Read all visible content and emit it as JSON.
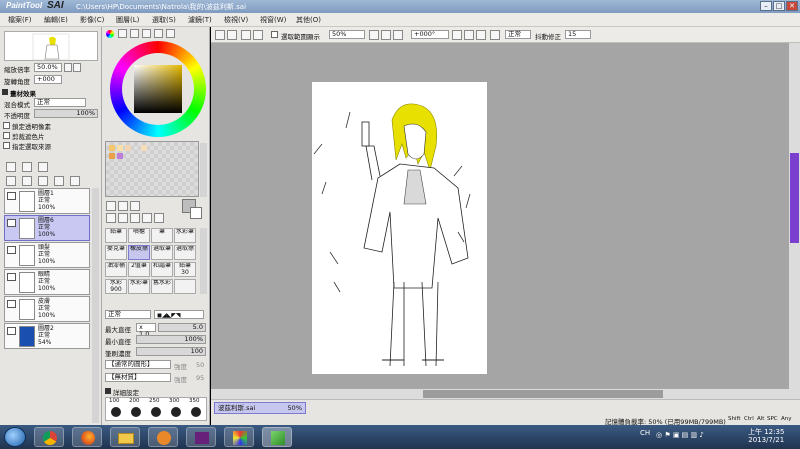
{
  "app": {
    "logo_text": "PaintTool",
    "logo_name": "SAI",
    "file_path": "C:\\Users\\HP\\Documents\\Natrola\\我的\\波茲利斯.sai"
  },
  "menubar": {
    "items": [
      "檔案(F)",
      "編輯(E)",
      "影像(C)",
      "圖層(L)",
      "選取(S)",
      "濾鏡(T)",
      "檢視(V)",
      "視窗(W)",
      "其他(O)"
    ]
  },
  "navigator": {
    "zoom_label": "縮放倍率",
    "zoom_value": "50.0%",
    "angle_label": "旋轉角度",
    "angle_value": "+000"
  },
  "layer_panel": {
    "effects_label": "畫材效果",
    "blend_label": "混合模式",
    "blend_value": "正常",
    "opacity_label": "不透明度",
    "opacity_value": "100%",
    "options": [
      "鎖定透明像素",
      "剪裁遮色片",
      "指定選取來源"
    ],
    "layers": [
      {
        "name": "圖層1",
        "mode": "正常",
        "opacity": "100%",
        "selected": false
      },
      {
        "name": "圖層6",
        "mode": "正常",
        "opacity": "100%",
        "selected": true
      },
      {
        "name": "頭髮",
        "mode": "正常",
        "opacity": "100%",
        "selected": false
      },
      {
        "name": "眼睛",
        "mode": "正常",
        "opacity": "100%",
        "selected": false
      },
      {
        "name": "皮膚",
        "mode": "正常",
        "opacity": "100%",
        "selected": false
      },
      {
        "name": "圖層2",
        "mode": "正常",
        "opacity": "54%",
        "selected": false
      }
    ]
  },
  "tools": {
    "brushes": [
      {
        "label": "鉛筆",
        "size": "",
        "selected": false
      },
      {
        "label": "噴槍",
        "size": "",
        "selected": false
      },
      {
        "label": "筆",
        "size": "",
        "selected": false
      },
      {
        "label": "水彩筆",
        "size": "",
        "selected": false
      },
      {
        "label": "麥克筆",
        "size": "",
        "selected": false
      },
      {
        "label": "橡皮擦",
        "size": "",
        "selected": true
      },
      {
        "label": "選取筆",
        "size": "",
        "selected": false
      },
      {
        "label": "選取擦",
        "size": "",
        "selected": false
      },
      {
        "label": "油漆桶",
        "size": "",
        "selected": false
      },
      {
        "label": "2值筆",
        "size": "",
        "selected": false
      },
      {
        "label": "和諧筆",
        "size": "",
        "selected": false
      },
      {
        "label": "鉛筆",
        "size": "30",
        "selected": false
      },
      {
        "label": "水彩",
        "size": "900",
        "selected": false
      },
      {
        "label": "水彩筆",
        "size": "",
        "selected": false
      },
      {
        "label": "舊水彩",
        "size": "",
        "selected": false
      },
      {
        "label": "",
        "size": "",
        "selected": false
      }
    ],
    "mode_value": "正常",
    "max_size_label": "最大直徑",
    "max_size_mult": "x 1.0",
    "max_size_value": "5.0",
    "min_size_label": "最小直徑",
    "min_size_value": "100%",
    "density_label": "筆刷濃度",
    "density_value": "100",
    "shape_label": "【通常的圓形】",
    "shape_strength": "強度",
    "shape_strength_value": "50",
    "texture_label": "【無材質】",
    "texture_strength": "強度",
    "texture_strength_value": "95",
    "advanced_label": "詳細設定",
    "size_presets": [
      "100",
      "200",
      "250",
      "300",
      "350"
    ]
  },
  "canvas_toolbar": {
    "checkbox_label": "選取範圍顯示",
    "zoom_value": "50%",
    "angle_value": "+000°",
    "mode_value": "正常",
    "stabilizer_label": "抖動修正",
    "stabilizer_value": "15"
  },
  "document": {
    "tab_name": "波茲利斯.sai",
    "tab_zoom": "50%"
  },
  "status": {
    "memory_text": "記憶體負載率: 50% (已用99MB/799MB)",
    "keys": [
      "Shift",
      "Ctrl",
      "Alt",
      "SPC",
      "Any"
    ]
  },
  "taskbar": {
    "tray_lang": "CH",
    "time": "上午 12:35",
    "date": "2013/7/21"
  },
  "colors": {
    "selection": "#c7c7ee",
    "primary_color": "#1a4fb0",
    "hair_color": "#e8e000"
  }
}
